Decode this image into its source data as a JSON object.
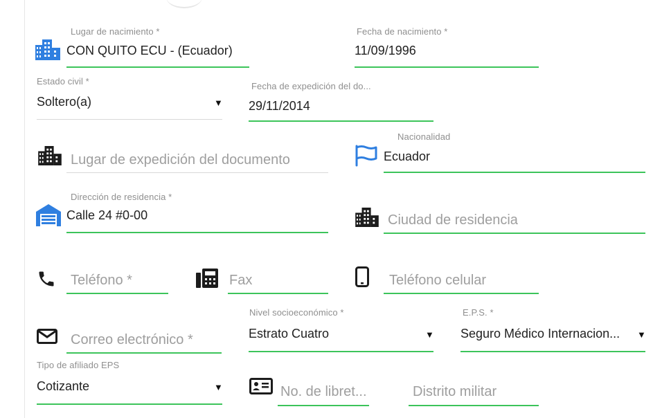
{
  "form": {
    "lugar_nacimiento": {
      "label": "Lugar de nacimiento *",
      "value": "CON QUITO ECU - (Ecuador)"
    },
    "fecha_nacimiento": {
      "label": "Fecha de nacimiento *",
      "value": "11/09/1996"
    },
    "estado_civil": {
      "label": "Estado civil *",
      "value": "Soltero(a)"
    },
    "fecha_expedicion": {
      "label": "Fecha de expedición del do...",
      "value": "29/11/2014"
    },
    "lugar_expedicion": {
      "placeholder": "Lugar de expedición del documento"
    },
    "nacionalidad": {
      "label": "Nacionalidad",
      "value": "Ecuador"
    },
    "direccion_residencia": {
      "label": "Dirección de residencia *",
      "value": "Calle 24 #0-00"
    },
    "ciudad_residencia": {
      "placeholder": "Ciudad de residencia"
    },
    "telefono": {
      "placeholder": "Teléfono *"
    },
    "fax": {
      "placeholder": "Fax"
    },
    "telefono_celular": {
      "placeholder": "Teléfono celular"
    },
    "correo": {
      "placeholder": "Correo electrónico *"
    },
    "nivel_socioeconomico": {
      "label": "Nivel socioeconómico *",
      "value": "Estrato Cuatro"
    },
    "eps": {
      "label": "E.P.S. *",
      "value": "Seguro Médico Internacion..."
    },
    "tipo_afiliado": {
      "label": "Tipo de afiliado EPS",
      "value": "Cotizante"
    },
    "libreta_militar": {
      "placeholder": "No. de libret..."
    },
    "distrito_militar": {
      "placeholder": "Distrito militar"
    }
  },
  "dropdown_arrow": "▼",
  "icons": {
    "city_blue": "city-icon",
    "city_dark": "city-icon",
    "flag": "flag-icon",
    "warehouse": "warehouse-icon",
    "phone": "phone-icon",
    "fax": "fax-icon",
    "mobile": "mobile-phone-icon",
    "mail": "envelope-icon",
    "id_card": "id-card-icon"
  },
  "colors": {
    "accent_line": "#3cc45a",
    "icon_blue": "#2f7fe0",
    "text": "#212121",
    "label": "#8f8f8f"
  }
}
